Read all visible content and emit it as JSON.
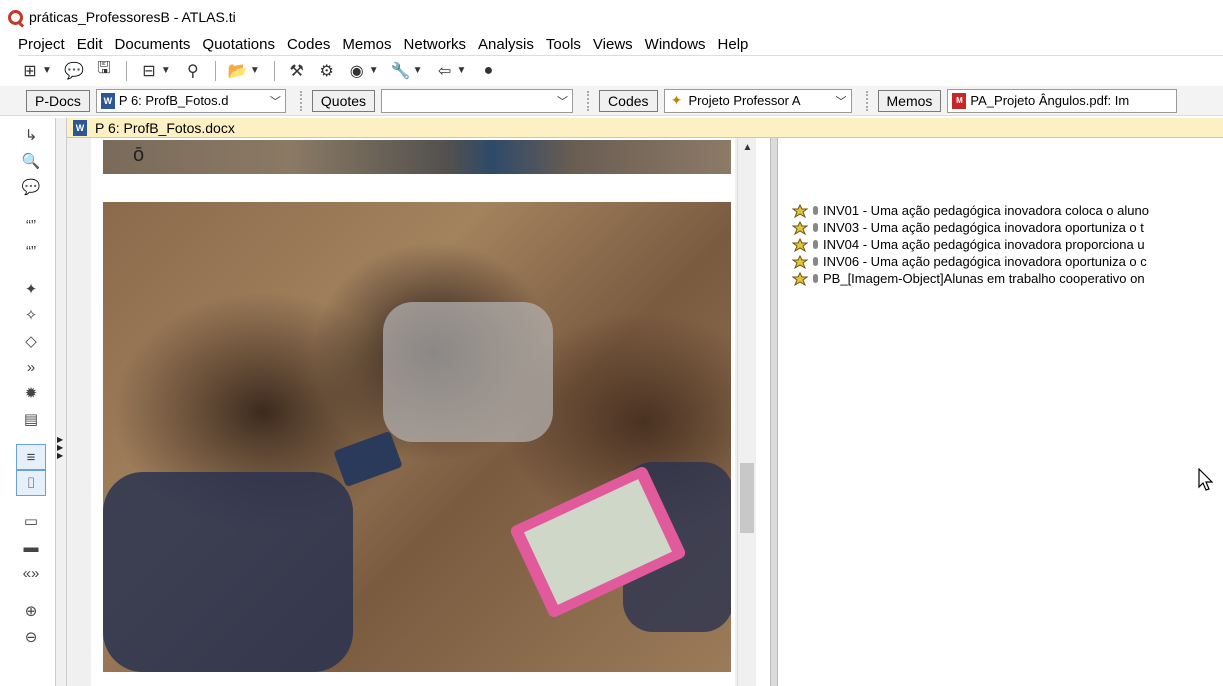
{
  "window": {
    "title": "práticas_ProfessoresB - ATLAS.ti"
  },
  "menu": {
    "items": [
      "Project",
      "Edit",
      "Documents",
      "Quotations",
      "Codes",
      "Memos",
      "Networks",
      "Analysis",
      "Tools",
      "Views",
      "Windows",
      "Help"
    ]
  },
  "toolbar2": {
    "pdocs_label": "P-Docs",
    "pdoc_selected": "P 6: ProfB_Fotos.d",
    "quotes_label": "Quotes",
    "quote_selected": "",
    "codes_label": "Codes",
    "code_selected": "Projeto Professor A",
    "memos_label": "Memos",
    "memo_selected": "PA_Projeto Ângulos.pdf: Im"
  },
  "document": {
    "tab_title": "P 6: ProfB_Fotos.docx"
  },
  "margin": {
    "codes": [
      "INV01 - Uma ação pedagógica inovadora coloca o aluno",
      "INV03 - Uma ação pedagógica inovadora oportuniza o t",
      "INV04 - Uma ação pedagógica inovadora proporciona u",
      "INV06 - Uma ação pedagógica inovadora oportuniza o c",
      "PB_[Imagem-Object]Alunas em trabalho cooperativo on"
    ]
  },
  "colors": {
    "doc_tab_bg": "#fdf0c2",
    "code_icon": "#b8860b",
    "pdf_icon": "#c62828",
    "word_icon": "#2b5797"
  }
}
